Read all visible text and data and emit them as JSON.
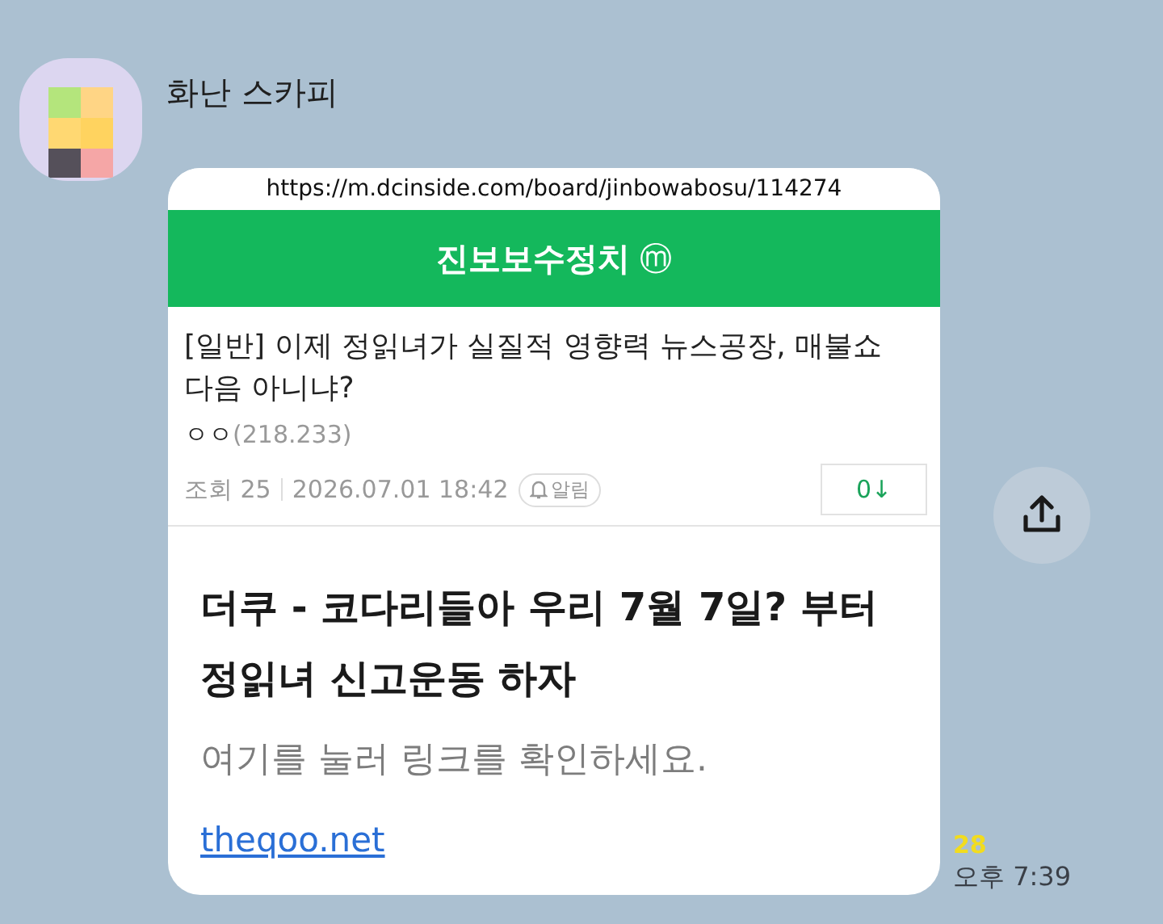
{
  "sender": {
    "name": "화난 스카피"
  },
  "preview": {
    "url": "https://m.dcinside.com/board/jinbowabosu/114274",
    "board": "진보보수정치",
    "board_badge": "ⓜ",
    "post_title": "[일반] 이제 정읽녀가 실질적 영향력 뉴스공장, 매불쇼 다음 아니냐?",
    "author": "ㅇㅇ",
    "author_ip": "(218.233)",
    "views": "조회 25",
    "date": "2026.07.01 18:42",
    "alert": "알림",
    "downvote": "0↓"
  },
  "link": {
    "title": "더쿠 - 코다리들아 우리 7월 7일? 부터 정읽녀 신고운동 하자",
    "description": "여기를 눌러 링크를 확인하세요.",
    "domain": "theqoo.net"
  },
  "unread": "28",
  "time": "오후 7:39"
}
